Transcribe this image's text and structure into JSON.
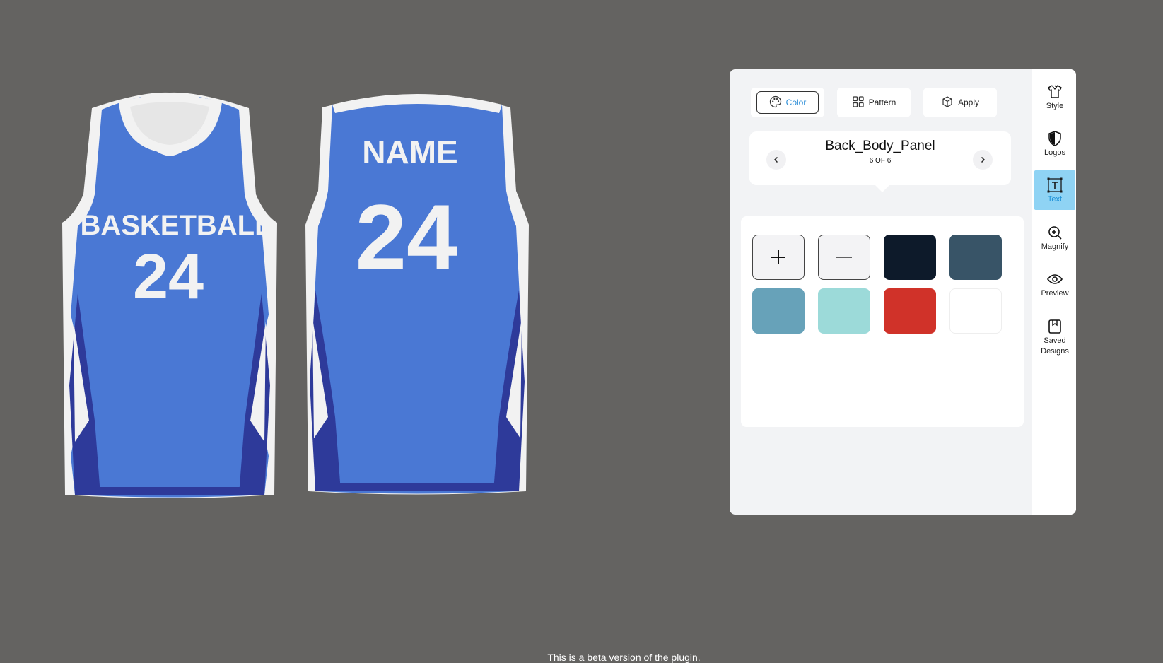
{
  "jersey_front": {
    "team_text": "BASKETBALL",
    "number": "24"
  },
  "jersey_back": {
    "name_text": "NAME",
    "number": "24"
  },
  "colors": {
    "background": "#646361",
    "jersey_blue": "#4a78d4",
    "jersey_dark": "#2e3a9a",
    "jersey_white": "#f2f2f2",
    "accent": "#2e8fd8"
  },
  "tabs": [
    {
      "label": "Color",
      "icon": "palette-icon",
      "active": true
    },
    {
      "label": "Pattern",
      "icon": "grid-icon",
      "active": false
    },
    {
      "label": "Apply",
      "icon": "cube-icon",
      "active": false
    }
  ],
  "part_selector": {
    "name": "Back_Body_Panel",
    "count": "6 OF 6"
  },
  "swatches": {
    "tools": [
      "plus-icon",
      "minus-icon"
    ],
    "colors": [
      "#0d1a2a",
      "#385467",
      "#67a2b9",
      "#9cdad9",
      "#d03229",
      "#ffffff"
    ]
  },
  "sidebar": {
    "items": [
      {
        "label": "Style",
        "icon": "shirt-icon",
        "active": false
      },
      {
        "label": "Logos",
        "icon": "shield-icon",
        "active": false
      },
      {
        "label": "Text",
        "icon": "text-icon",
        "active": true
      },
      {
        "label": "Magnify",
        "icon": "zoom-in-icon",
        "active": false
      },
      {
        "label": "Preview",
        "icon": "eye-icon",
        "active": false
      },
      {
        "label": "Saved Designs",
        "icon": "bookmark-icon",
        "active": false
      }
    ]
  },
  "footer": {
    "text": "This is a beta version of the plugin."
  }
}
